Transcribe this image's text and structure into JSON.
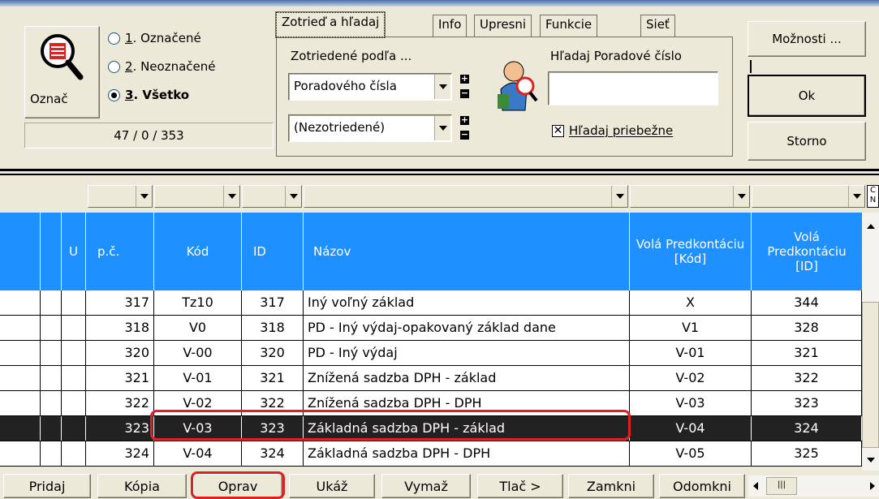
{
  "mark": {
    "button_label": "Označ",
    "options": [
      {
        "num": "1",
        "label": ". Označené",
        "checked": false
      },
      {
        "num": "2",
        "label": ". Neoznačené",
        "checked": false
      },
      {
        "num": "3",
        "label": ". Všetko",
        "checked": true
      }
    ],
    "counter": "47 / 0 / 353"
  },
  "tabs": [
    {
      "label": "Zotrieď a hľadaj",
      "active": true
    },
    {
      "label": "Info",
      "active": false
    },
    {
      "label": "Upresni",
      "active": false
    },
    {
      "label": "Funkcie",
      "active": false
    },
    {
      "label": "Sieť",
      "active": false
    }
  ],
  "sort": {
    "label": "Zotriedené podľa ...",
    "primary_value": "Poradového čísla",
    "secondary_value": "(Nezotriedené)"
  },
  "search": {
    "label": "Hľadaj Poradové číslo",
    "value": "",
    "continuous_label": "Hľadaj priebežne",
    "continuous_checked": true
  },
  "right_buttons": {
    "options": "Možnosti ...",
    "ok": "Ok",
    "cancel": "Storno"
  },
  "grid": {
    "corner_label_1": "C",
    "corner_label_2": "N",
    "columns": [
      "U",
      "p.č.",
      "Kód",
      "ID",
      "Názov",
      "Volá Predkontáciu [Kód]",
      "Volá Predkontáciu [ID]"
    ],
    "rows": [
      {
        "pc": "317",
        "kod": "Tz10",
        "id": "317",
        "nazov": "Iný voľný základ",
        "pk": "X",
        "pid": "344"
      },
      {
        "pc": "318",
        "kod": "V0",
        "id": "318",
        "nazov": "PD - Iný výdaj-opakovaný základ dane",
        "pk": "V1",
        "pid": "328"
      },
      {
        "pc": "320",
        "kod": "V-00",
        "id": "320",
        "nazov": "PD - Iný výdaj",
        "pk": "V-01",
        "pid": "321"
      },
      {
        "pc": "321",
        "kod": "V-01",
        "id": "321",
        "nazov": "Znížená sadzba DPH - základ",
        "pk": "V-02",
        "pid": "322"
      },
      {
        "pc": "322",
        "kod": "V-02",
        "id": "322",
        "nazov": "Znížená sadzba DPH - DPH",
        "pk": "V-03",
        "pid": "323"
      },
      {
        "pc": "323",
        "kod": "V-03",
        "id": "323",
        "nazov": "Základná sadzba DPH - základ",
        "pk": "V-04",
        "pid": "324",
        "selected": true
      },
      {
        "pc": "324",
        "kod": "V-04",
        "id": "324",
        "nazov": "Základná sadzba DPH - DPH",
        "pk": "V-05",
        "pid": "325"
      }
    ]
  },
  "bottom_buttons": [
    {
      "name": "pridaj-button",
      "label": "Pridaj"
    },
    {
      "name": "kopia-button",
      "label": "Kópia"
    },
    {
      "name": "oprav-button",
      "label": "Oprav"
    },
    {
      "name": "ukaz-button",
      "label": "Ukáž"
    },
    {
      "name": "vymaz-button",
      "label": "Vymaž"
    },
    {
      "name": "tlac-button",
      "label": "Tlač >"
    },
    {
      "name": "zamkni-button",
      "label": "Zamkni"
    },
    {
      "name": "odomkni-button",
      "label": "Odomkni"
    }
  ],
  "colors": {
    "header_bg": "#1e90ff",
    "selected_row_bg": "#222222",
    "highlight": "#e02020"
  }
}
